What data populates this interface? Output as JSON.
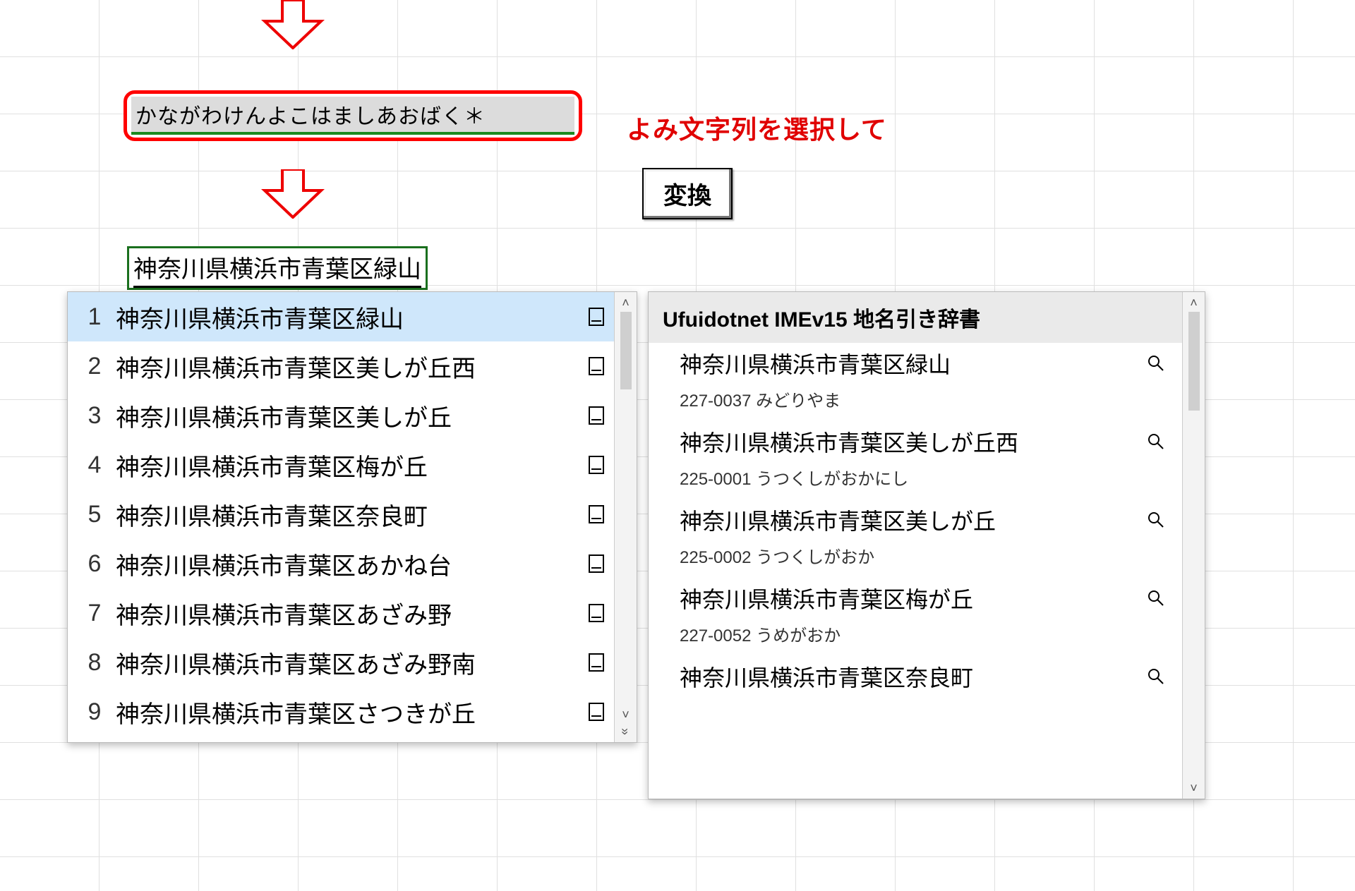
{
  "annotation": {
    "select_reading": "よみ文字列を選択して",
    "convert_key": "変換"
  },
  "ime": {
    "reading_input": "かながわけんよこはましあおばく＊",
    "converted_display": "神奈川県横浜市青葉区緑山",
    "candidates": [
      {
        "n": "1",
        "text": "神奈川県横浜市青葉区緑山"
      },
      {
        "n": "2",
        "text": "神奈川県横浜市青葉区美しが丘西"
      },
      {
        "n": "3",
        "text": "神奈川県横浜市青葉区美しが丘"
      },
      {
        "n": "4",
        "text": "神奈川県横浜市青葉区梅が丘"
      },
      {
        "n": "5",
        "text": "神奈川県横浜市青葉区奈良町"
      },
      {
        "n": "6",
        "text": "神奈川県横浜市青葉区あかね台"
      },
      {
        "n": "7",
        "text": "神奈川県横浜市青葉区あざみ野"
      },
      {
        "n": "8",
        "text": "神奈川県横浜市青葉区あざみ野南"
      },
      {
        "n": "9",
        "text": "神奈川県横浜市青葉区さつきが丘"
      }
    ]
  },
  "dictionary": {
    "title": "Ufuidotnet IMEv15 地名引き辞書",
    "items": [
      {
        "name": "神奈川県横浜市青葉区緑山",
        "detail": "227-0037 みどりやま"
      },
      {
        "name": "神奈川県横浜市青葉区美しが丘西",
        "detail": "225-0001 うつくしがおかにし"
      },
      {
        "name": "神奈川県横浜市青葉区美しが丘",
        "detail": "225-0002 うつくしがおか"
      },
      {
        "name": "神奈川県横浜市青葉区梅が丘",
        "detail": "227-0052 うめがおか"
      },
      {
        "name": "神奈川県横浜市青葉区奈良町",
        "detail": ""
      }
    ]
  },
  "icons": {
    "scroll_up": "˄",
    "scroll_down": "˅",
    "expand": "»"
  }
}
